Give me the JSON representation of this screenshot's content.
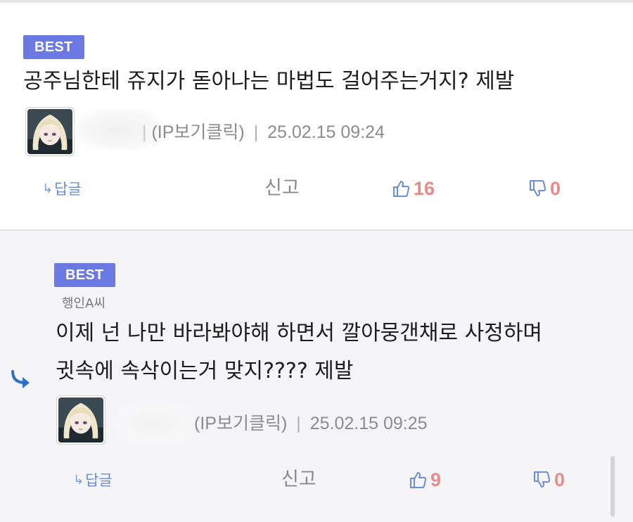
{
  "colors": {
    "badge_bg": "#6a79e3",
    "vote_icon": "#6a8dd8",
    "vote_count": "#e58d88",
    "reply_bg": "#f5f5f8"
  },
  "comments": [
    {
      "badge": "BEST",
      "text": "공주님한테 쥬지가 돋아나는 마법도 걸어주는거지? 제발",
      "author_suffix": "|",
      "ip_label": "(IP보기클릭)",
      "separator": "|",
      "timestamp": "25.02.15 09:24",
      "actions": {
        "reply_icon": "reply-arrow-icon",
        "reply_label": "답글",
        "report_label": "신고",
        "upvotes": "16",
        "downvotes": "0"
      }
    },
    {
      "badge": "BEST",
      "reply_to": "행인A씨",
      "text_line1": "이제 넌 나만 바라봐야해 하면서 깔아뭉갠채로 사정하며",
      "text_line2": "귓속에 속삭이는거 맞지???? 제발",
      "ip_label": "(IP보기클릭)",
      "separator": "|",
      "timestamp": "25.02.15 09:25",
      "actions": {
        "reply_icon": "reply-arrow-icon",
        "reply_label": "답글",
        "report_label": "신고",
        "upvotes": "9",
        "downvotes": "0"
      }
    }
  ]
}
